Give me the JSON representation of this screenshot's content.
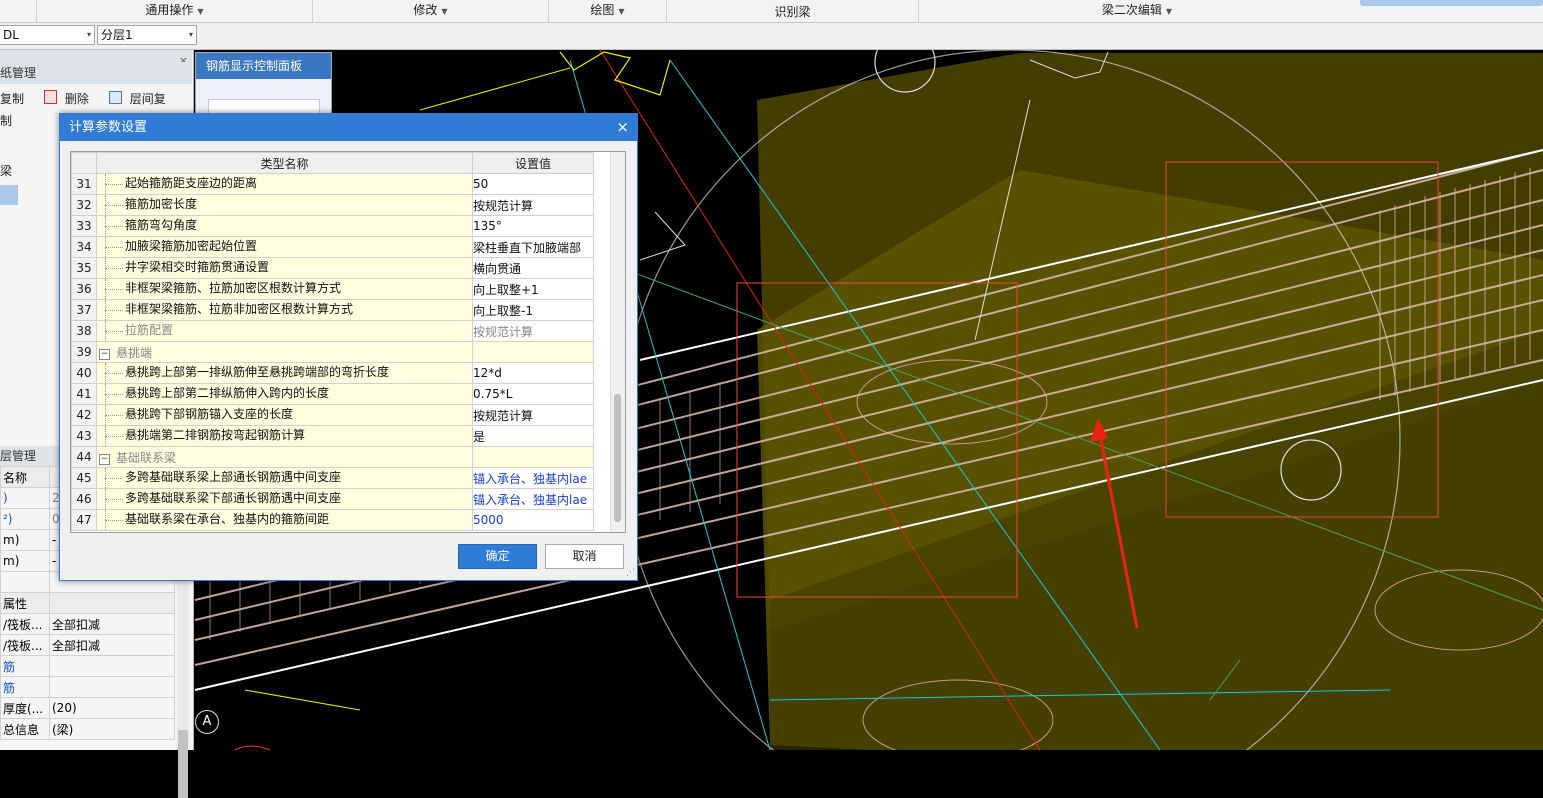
{
  "ribbon": {
    "groups": [
      {
        "label": "通用操作",
        "dropdown": true
      },
      {
        "label": "修改",
        "dropdown": true
      },
      {
        "label": "绘图",
        "dropdown": true
      },
      {
        "label": "识别梁",
        "dropdown": false
      },
      {
        "label": "梁二次编辑",
        "dropdown": true
      }
    ]
  },
  "toolbar": {
    "combo1": "DL",
    "combo2": "分层1",
    "combo1_arrow": "▾",
    "combo2_arrow": "▾"
  },
  "left_panel": {
    "title_top": "纸管理",
    "close_glyph": "×",
    "tools": {
      "copy": "复制",
      "delete": "删除",
      "floor_copy": "层间复制",
      "more": "▸▸"
    },
    "tree_item": "梁",
    "title_bottom": "层管理",
    "properties": [
      {
        "c1": "名称",
        "c2": "",
        "group": true
      },
      {
        "c1": ")",
        "c2": "2",
        "c1_blue": true,
        "c2_grey": true
      },
      {
        "c1": "²)",
        "c2": "0",
        "c1_blue": true,
        "c2_grey": true
      },
      {
        "c1": "m)",
        "c2": "-"
      },
      {
        "c1": "m)",
        "c2": "-"
      },
      {
        "c1": "",
        "c2": ""
      },
      {
        "c1": "属性",
        "c2": "",
        "group": true
      },
      {
        "c1": "/筏板...",
        "c2": "全部扣减"
      },
      {
        "c1": "/筏板...",
        "c2": "全部扣减"
      },
      {
        "c1": "筋",
        "c2": "",
        "c1_blue": true
      },
      {
        "c1": "筋",
        "c2": "",
        "c1_blue": true
      },
      {
        "c1": "厚度(...",
        "c2": "(20)"
      },
      {
        "c1": "总信息",
        "c2": "(梁)"
      }
    ]
  },
  "rebar_panel": {
    "title": "钢筋显示控制面板"
  },
  "dialog": {
    "title": "计算参数设置",
    "close_glyph": "×",
    "columns": {
      "name": "类型名称",
      "value": "设置值"
    },
    "rows": [
      {
        "num": "31",
        "name": "起始箍筋距支座边的距离",
        "value": "50"
      },
      {
        "num": "32",
        "name": "箍筋加密长度",
        "value": "按规范计算"
      },
      {
        "num": "33",
        "name": "箍筋弯勾角度",
        "value": "135°"
      },
      {
        "num": "34",
        "name": "加腋梁箍筋加密起始位置",
        "value": "梁柱垂直下加腋端部"
      },
      {
        "num": "35",
        "name": "井字梁相交时箍筋贯通设置",
        "value": "横向贯通"
      },
      {
        "num": "36",
        "name": "非框架梁箍筋、拉筋加密区根数计算方式",
        "value": "向上取整+1"
      },
      {
        "num": "37",
        "name": "非框架梁箍筋、拉筋非加密区根数计算方式",
        "value": "向上取整-1"
      },
      {
        "num": "38",
        "name": "拉筋配置",
        "value": "按规范计算",
        "disabled": true
      },
      {
        "num": "39",
        "name": "悬挑端",
        "value": "",
        "category": true
      },
      {
        "num": "40",
        "name": "悬挑跨上部第一排纵筋伸至悬挑跨端部的弯折长度",
        "value": "12*d"
      },
      {
        "num": "41",
        "name": "悬挑跨上部第二排纵筋伸入跨内的长度",
        "value": "0.75*L"
      },
      {
        "num": "42",
        "name": "悬挑跨下部钢筋锚入支座的长度",
        "value": "按规范计算"
      },
      {
        "num": "43",
        "name": "悬挑端第二排钢筋按弯起钢筋计算",
        "value": "是"
      },
      {
        "num": "44",
        "name": "基础联系梁",
        "value": "",
        "category": true
      },
      {
        "num": "45",
        "name": "多跨基础联系梁上部通长钢筋遇中间支座",
        "value": "锚入承台、独基内lae",
        "blue": true
      },
      {
        "num": "46",
        "name": "多跨基础联系梁下部通长钢筋遇中间支座",
        "value": "锚入承台、独基内lae",
        "blue": true
      },
      {
        "num": "47",
        "name": "基础联系梁在承台、独基内的箍筋间距",
        "value": "5000",
        "blue": true
      }
    ],
    "ok": "确定",
    "cancel": "取消"
  },
  "viewport": {
    "axis_label": "A"
  }
}
